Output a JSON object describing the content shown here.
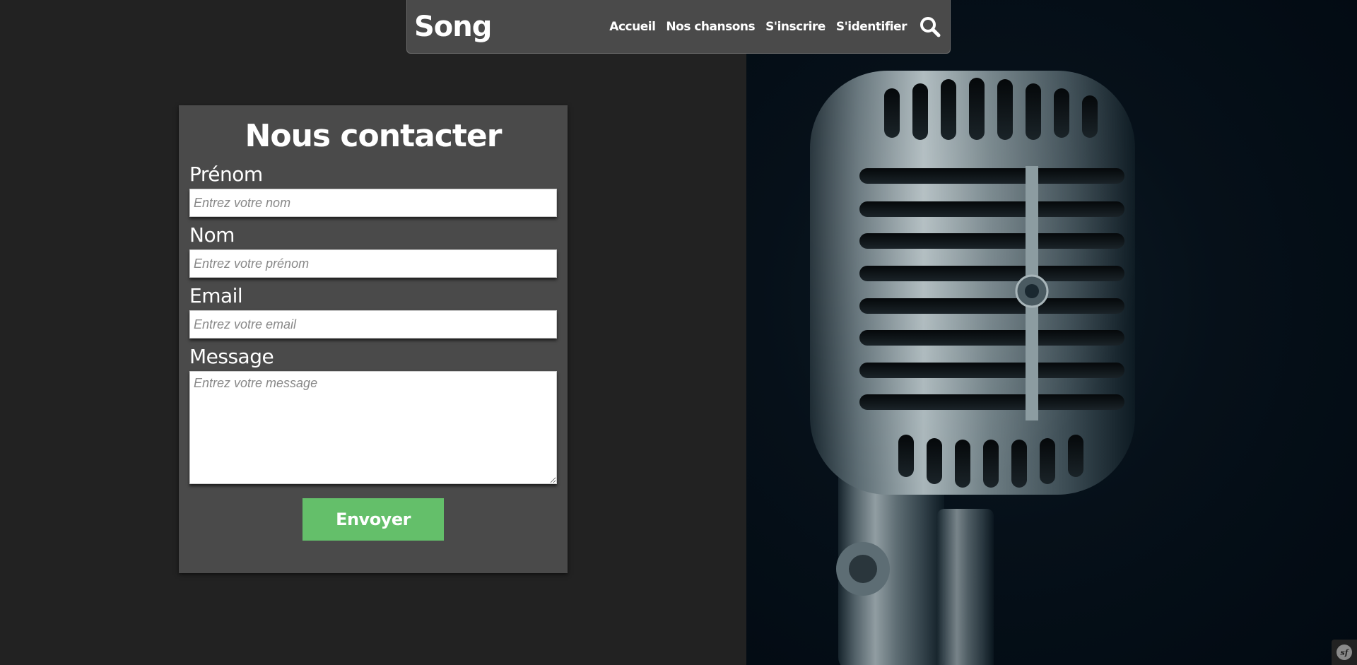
{
  "header": {
    "brand": "Song",
    "nav": [
      {
        "label": "Accueil"
      },
      {
        "label": "Nos chansons"
      },
      {
        "label": "S'inscrire"
      },
      {
        "label": "S'identifier"
      }
    ],
    "search_icon": "search-icon"
  },
  "contact_form": {
    "title": "Nous contacter",
    "fields": {
      "prenom": {
        "label": "Prénom",
        "placeholder": "Entrez votre nom",
        "value": ""
      },
      "nom": {
        "label": "Nom",
        "placeholder": "Entrez votre prénom",
        "value": ""
      },
      "email": {
        "label": "Email",
        "placeholder": "Entrez votre email",
        "value": ""
      },
      "message": {
        "label": "Message",
        "placeholder": "Entrez votre message",
        "value": ""
      }
    },
    "submit_label": "Envoyer"
  },
  "toolbar": {
    "logo_text": "sf"
  },
  "colors": {
    "background": "#222222",
    "panel": "#4a4a4a",
    "accent_green": "#64bf6a",
    "hero_dark": "#020a12"
  },
  "hero_image": "microphone-photo"
}
